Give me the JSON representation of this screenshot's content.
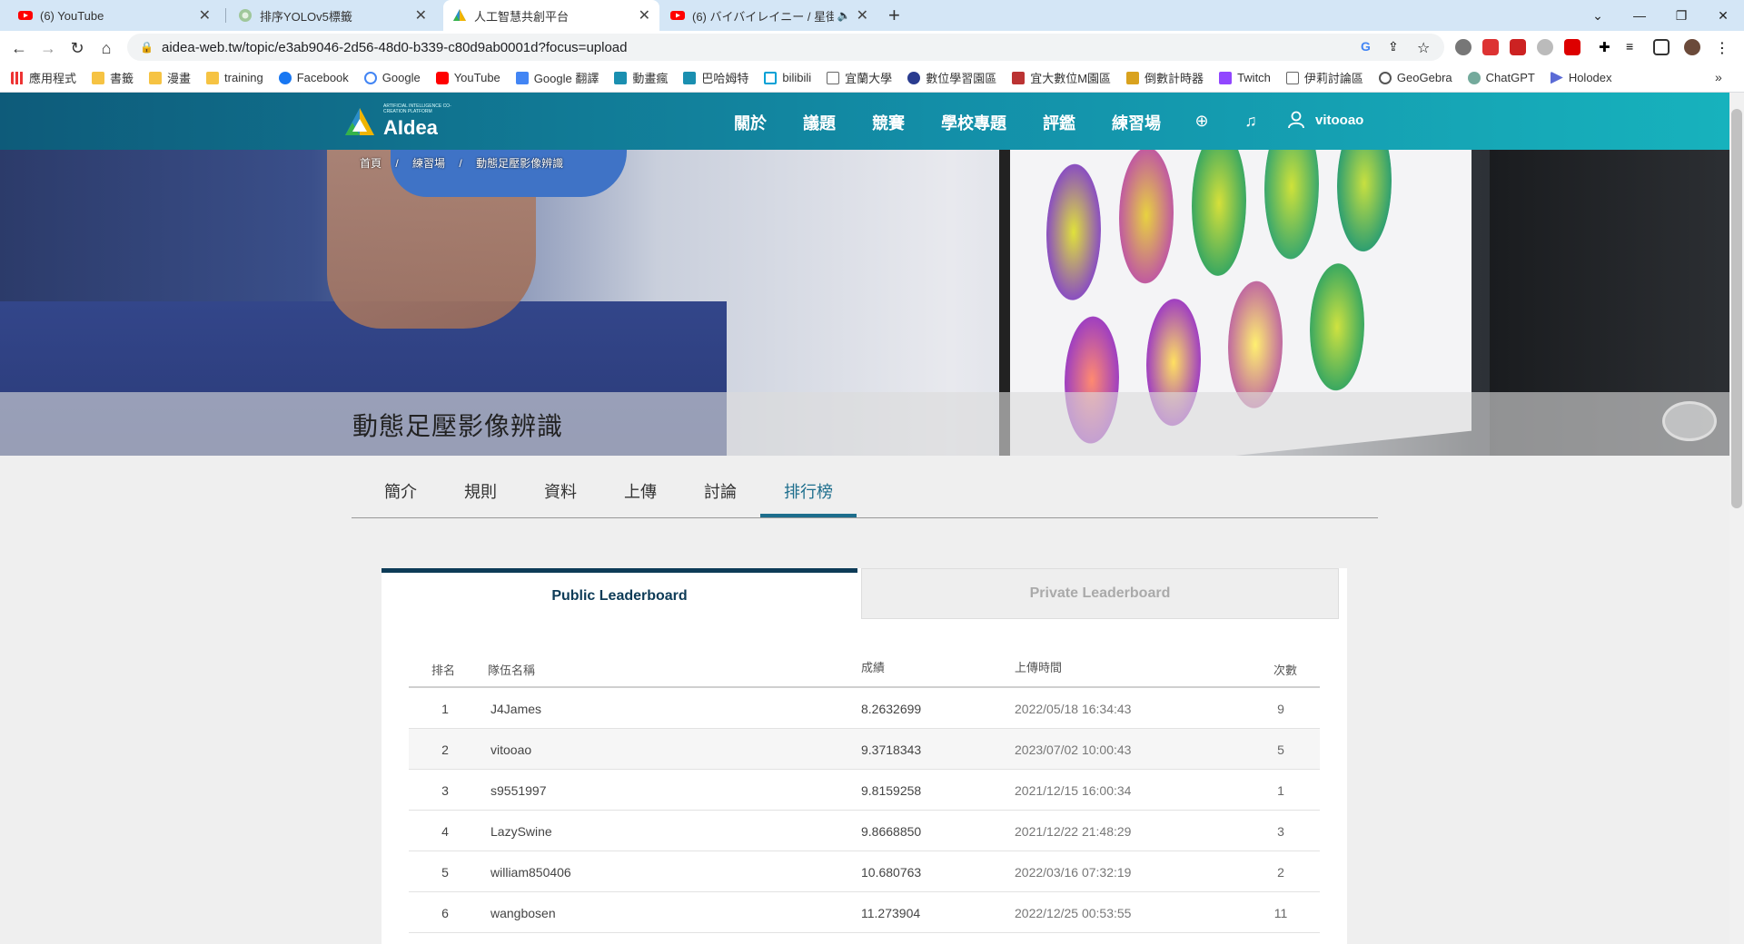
{
  "browser": {
    "tabs": [
      {
        "title": "(6) YouTube",
        "favicon": "youtube-icon",
        "active": false
      },
      {
        "title": "排序YOLOv5標籤",
        "favicon": "generic-site-icon",
        "active": false
      },
      {
        "title": "人工智慧共創平台",
        "favicon": "aidea-icon",
        "active": true
      },
      {
        "title": "(6) バイバイレイニー / 星街",
        "favicon": "youtube-icon",
        "active": false
      }
    ],
    "new_tab": "+",
    "url": "aidea-web.tw/topic/e3ab9046-2d56-48d0-b339-c80d9ab0001d?focus=upload",
    "bookmarks": [
      "應用程式",
      "書籤",
      "漫畫",
      "training",
      "Facebook",
      "Google",
      "YouTube",
      "Google 翻譯",
      "動畫瘋",
      "巴哈姆特",
      "bilibili",
      "宜蘭大學",
      "數位學習園區",
      "宜大數位M園區",
      "倒數計時器",
      "Twitch",
      "伊莉討論區",
      "GeoGebra",
      "ChatGPT",
      "Holodex"
    ],
    "more_bookmarks": "»"
  },
  "site": {
    "logo": "AIdea",
    "logo_tagline": "ARTIFICIAL INTELLIGENCE CO-CREATION PLATFORM",
    "nav": [
      "關於",
      "議題",
      "競賽",
      "學校專題",
      "評鑑",
      "練習場"
    ],
    "username": "vitooao",
    "breadcrumb": [
      "首頁",
      "/",
      "練習場",
      "/",
      "動態足壓影像辨識"
    ],
    "page_title": "動態足壓影像辨識",
    "tabs": [
      "簡介",
      "規則",
      "資料",
      "上傳",
      "討論",
      "排行榜"
    ],
    "active_tab": "排行榜"
  },
  "leaderboard": {
    "public_label": "Public Leaderboard",
    "private_label": "Private Leaderboard",
    "headers": {
      "rank": "排名",
      "team": "隊伍名稱",
      "score": "成績",
      "time": "上傳時間",
      "count": "次數"
    },
    "rows": [
      {
        "rank": "1",
        "team": "J4James",
        "score": "8.2632699",
        "time": "2022/05/18 16:34:43",
        "count": "9"
      },
      {
        "rank": "2",
        "team": "vitooao",
        "score": "9.3718343",
        "time": "2023/07/02 10:00:43",
        "count": "5"
      },
      {
        "rank": "3",
        "team": "s9551997",
        "score": "9.8159258",
        "time": "2021/12/15 16:00:34",
        "count": "1"
      },
      {
        "rank": "4",
        "team": "LazySwine",
        "score": "9.8668850",
        "time": "2021/12/22 21:48:29",
        "count": "3"
      },
      {
        "rank": "5",
        "team": "william850406",
        "score": "10.680763",
        "time": "2022/03/16 07:32:19",
        "count": "2"
      },
      {
        "rank": "6",
        "team": "wangbosen",
        "score": "11.273904",
        "time": "2022/12/25 00:53:55",
        "count": "11"
      }
    ]
  },
  "colors": {
    "nav_start": "#0e5b7a",
    "nav_end": "#17b2bd",
    "accent": "#0d3b57",
    "tab_underline": "#1d6e8d"
  }
}
